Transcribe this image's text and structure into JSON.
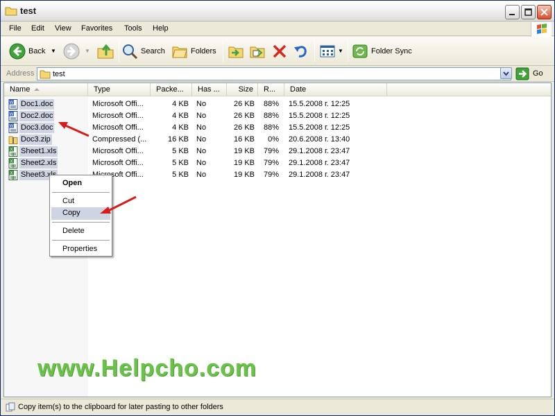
{
  "window": {
    "title": "test"
  },
  "menubar": {
    "items": [
      "File",
      "Edit",
      "View",
      "Favorites",
      "Tools",
      "Help"
    ]
  },
  "toolbar": {
    "back_label": "Back",
    "search_label": "Search",
    "folders_label": "Folders",
    "folder_sync_label": "Folder Sync"
  },
  "address": {
    "label": "Address",
    "value": "test",
    "go_label": "Go"
  },
  "columns": [
    "Name",
    "Type",
    "Packe...",
    "Has ...",
    "Size",
    "R...",
    "Date"
  ],
  "files": [
    {
      "name": "Doc1.doc",
      "type": "Microsoft Offi...",
      "packed": "4 KB",
      "has": "No",
      "size": "26 KB",
      "ratio": "88%",
      "date": "15.5.2008 г. 12:25",
      "icon": "word-doc-icon"
    },
    {
      "name": "Doc2.doc",
      "type": "Microsoft Offi...",
      "packed": "4 KB",
      "has": "No",
      "size": "26 KB",
      "ratio": "88%",
      "date": "15.5.2008 г. 12:25",
      "icon": "word-doc-icon"
    },
    {
      "name": "Doc3.doc",
      "type": "Microsoft Offi...",
      "packed": "4 KB",
      "has": "No",
      "size": "26 KB",
      "ratio": "88%",
      "date": "15.5.2008 г. 12:25",
      "icon": "word-doc-icon"
    },
    {
      "name": "Doc3.zip",
      "type": "Compressed (...",
      "packed": "16 KB",
      "has": "No",
      "size": "16 KB",
      "ratio": "0%",
      "date": "20.6.2008 г. 13:40",
      "icon": "zip-folder-icon"
    },
    {
      "name": "Sheet1.xls",
      "type": "Microsoft Offi...",
      "packed": "5 KB",
      "has": "No",
      "size": "19 KB",
      "ratio": "79%",
      "date": "29.1.2008 г. 23:47",
      "icon": "excel-sheet-icon"
    },
    {
      "name": "Sheet2.xls",
      "type": "Microsoft Offi...",
      "packed": "5 KB",
      "has": "No",
      "size": "19 KB",
      "ratio": "79%",
      "date": "29.1.2008 г. 23:47",
      "icon": "excel-sheet-icon"
    },
    {
      "name": "Sheet3.xls",
      "type": "Microsoft Offi...",
      "packed": "5 KB",
      "has": "No",
      "size": "19 KB",
      "ratio": "79%",
      "date": "29.1.2008 г. 23:47",
      "icon": "excel-sheet-icon"
    }
  ],
  "context_menu": {
    "open": "Open",
    "cut": "Cut",
    "copy": "Copy",
    "delete": "Delete",
    "properties": "Properties",
    "highlighted": "Copy"
  },
  "watermark": "www.Helpcho.com",
  "statusbar": {
    "text": "Copy item(s) to the clipboard for later pasting to other folders"
  },
  "colors": {
    "selection": "#cfd4e2",
    "annotation_arrow": "#d81c1c",
    "watermark": "#6bc24a"
  }
}
